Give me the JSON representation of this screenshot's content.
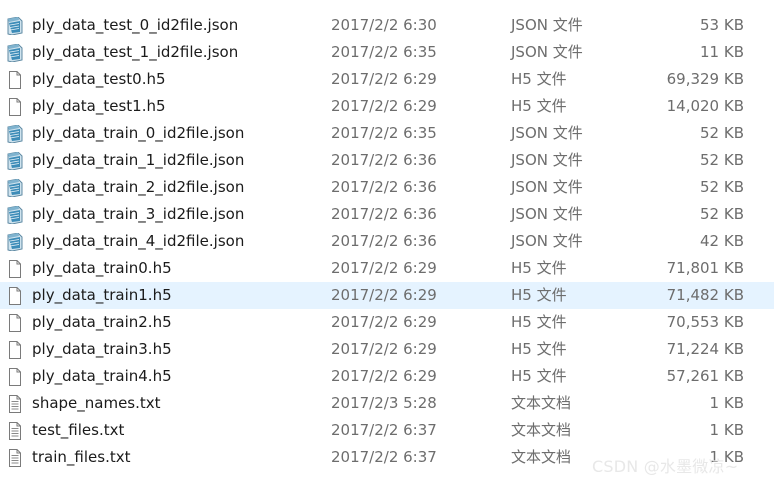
{
  "files": [
    {
      "name": "ply_data_test_0_id2file.json",
      "date": "2017/2/2 6:30",
      "type": "JSON 文件",
      "size": "53 KB",
      "icon": "json-file-icon"
    },
    {
      "name": "ply_data_test_1_id2file.json",
      "date": "2017/2/2 6:35",
      "type": "JSON 文件",
      "size": "11 KB",
      "icon": "json-file-icon"
    },
    {
      "name": "ply_data_test0.h5",
      "date": "2017/2/2 6:29",
      "type": "H5 文件",
      "size": "69,329 KB",
      "icon": "blank-file-icon"
    },
    {
      "name": "ply_data_test1.h5",
      "date": "2017/2/2 6:29",
      "type": "H5 文件",
      "size": "14,020 KB",
      "icon": "blank-file-icon"
    },
    {
      "name": "ply_data_train_0_id2file.json",
      "date": "2017/2/2 6:35",
      "type": "JSON 文件",
      "size": "52 KB",
      "icon": "json-file-icon"
    },
    {
      "name": "ply_data_train_1_id2file.json",
      "date": "2017/2/2 6:36",
      "type": "JSON 文件",
      "size": "52 KB",
      "icon": "json-file-icon"
    },
    {
      "name": "ply_data_train_2_id2file.json",
      "date": "2017/2/2 6:36",
      "type": "JSON 文件",
      "size": "52 KB",
      "icon": "json-file-icon"
    },
    {
      "name": "ply_data_train_3_id2file.json",
      "date": "2017/2/2 6:36",
      "type": "JSON 文件",
      "size": "52 KB",
      "icon": "json-file-icon"
    },
    {
      "name": "ply_data_train_4_id2file.json",
      "date": "2017/2/2 6:36",
      "type": "JSON 文件",
      "size": "42 KB",
      "icon": "json-file-icon"
    },
    {
      "name": "ply_data_train0.h5",
      "date": "2017/2/2 6:29",
      "type": "H5 文件",
      "size": "71,801 KB",
      "icon": "blank-file-icon"
    },
    {
      "name": "ply_data_train1.h5",
      "date": "2017/2/2 6:29",
      "type": "H5 文件",
      "size": "71,482 KB",
      "icon": "blank-file-icon",
      "selected": true
    },
    {
      "name": "ply_data_train2.h5",
      "date": "2017/2/2 6:29",
      "type": "H5 文件",
      "size": "70,553 KB",
      "icon": "blank-file-icon"
    },
    {
      "name": "ply_data_train3.h5",
      "date": "2017/2/2 6:29",
      "type": "H5 文件",
      "size": "71,224 KB",
      "icon": "blank-file-icon"
    },
    {
      "name": "ply_data_train4.h5",
      "date": "2017/2/2 6:29",
      "type": "H5 文件",
      "size": "57,261 KB",
      "icon": "blank-file-icon"
    },
    {
      "name": "shape_names.txt",
      "date": "2017/2/3 5:28",
      "type": "文本文档",
      "size": "1 KB",
      "icon": "text-file-icon"
    },
    {
      "name": "test_files.txt",
      "date": "2017/2/2 6:37",
      "type": "文本文档",
      "size": "1 KB",
      "icon": "text-file-icon"
    },
    {
      "name": "train_files.txt",
      "date": "2017/2/2 6:37",
      "type": "文本文档",
      "size": "1 KB",
      "icon": "text-file-icon"
    }
  ],
  "selected_row_color": "#e5f3ff",
  "watermark": "CSDN @水墨微凉~"
}
